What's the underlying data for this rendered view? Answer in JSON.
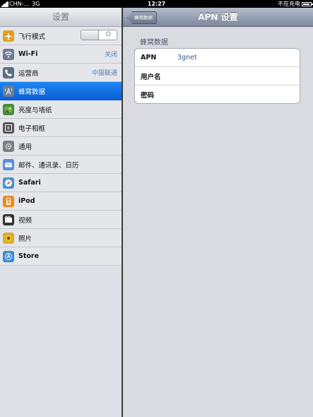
{
  "status_bar": {
    "carrier": "CHN-... ",
    "network": "3G",
    "time": "12:27",
    "charging": "不在充电",
    "battery_level": 0.9
  },
  "left_panel": {
    "title": "设置",
    "items": [
      {
        "label": "飞行模式",
        "icon": "airplane-icon",
        "icon_color": "#e0a020",
        "toggle": "O"
      },
      {
        "label": "Wi-Fi",
        "icon": "wifi-icon",
        "icon_color": "#6b7c93",
        "value": "关闭"
      },
      {
        "label": "运营商",
        "icon": "phone-icon",
        "icon_color": "#5b6e86",
        "value": "中国联通"
      },
      {
        "label": "蜂窝数据",
        "icon": "cellular-tower-icon",
        "icon_color": "#6b7c93",
        "selected": true
      },
      {
        "label": "亮度与墙纸",
        "icon": "brightness-wallpaper-icon",
        "icon_color": "#4a8a3a"
      },
      {
        "label": "电子相框",
        "icon": "picture-frame-icon",
        "icon_color": "#555555"
      },
      {
        "label": "通用",
        "icon": "gear-icon",
        "icon_color": "#7a7f87"
      },
      {
        "label": "邮件、通讯录、日历",
        "icon": "mail-icon",
        "icon_color": "#5b8fd8"
      },
      {
        "label": "Safari",
        "icon": "safari-compass-icon",
        "icon_color": "#4a90d9"
      },
      {
        "label": "iPod",
        "icon": "ipod-icon",
        "icon_color": "#f08a1a"
      },
      {
        "label": "视频",
        "icon": "video-icon",
        "icon_color": "#333333"
      },
      {
        "label": "照片",
        "icon": "sunflower-photo-icon",
        "icon_color": "#d8b030"
      },
      {
        "label": "Store",
        "icon": "store-icon",
        "icon_color": "#3a8ad8"
      }
    ]
  },
  "right_panel": {
    "title": "APN 设置",
    "back_label": "蜂窝数据",
    "section_label": "蜂窝数据",
    "fields": [
      {
        "label": "APN",
        "value": "3gnet"
      },
      {
        "label": "用户名",
        "value": ""
      },
      {
        "label": "密码",
        "value": ""
      }
    ]
  }
}
